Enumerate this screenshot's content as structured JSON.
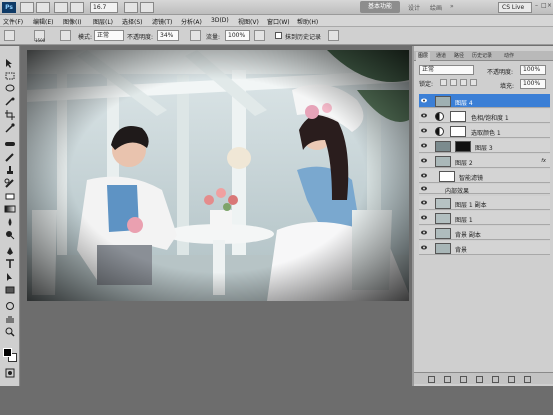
{
  "app": {
    "logo": "Ps",
    "zoom": "16.7",
    "workspace_active": "基本功能",
    "workspace_links": [
      "设计",
      "绘画"
    ],
    "cslive": "CS Live"
  },
  "menu": [
    "文件(F)",
    "编辑(E)",
    "图像(I)",
    "图层(L)",
    "选择(S)",
    "滤镜(T)",
    "分析(A)",
    "3D(D)",
    "视图(V)",
    "窗口(W)",
    "帮助(H)"
  ],
  "options": {
    "brush_size": "1500",
    "mode_label": "模式:",
    "mode_value": "正常",
    "opacity_label": "不透明度:",
    "opacity_value": "34%",
    "flow_label": "流量:",
    "flow_value": "100%",
    "history_label": "抹到历史记录"
  },
  "layers_panel": {
    "tabs": [
      "图层",
      "通道",
      "路径",
      "历史记录",
      "动作"
    ],
    "blend_mode": "正常",
    "opacity_label": "不透明度:",
    "opacity_value": "100%",
    "lock_label": "锁定:",
    "fill_label": "填充:",
    "fill_value": "100%",
    "layers": [
      {
        "name": "图层 4",
        "type": "pixel",
        "selected": true
      },
      {
        "name": "色相/饱和度 1",
        "type": "adjustment"
      },
      {
        "name": "选取颜色 1",
        "type": "adjustment"
      },
      {
        "name": "图层 3",
        "type": "pixel-mask"
      },
      {
        "name": "图层 2",
        "type": "smart",
        "fx": "fx"
      },
      {
        "name": "智能滤镜",
        "type": "smart-filter"
      },
      {
        "name": "内部效果",
        "type": "effect"
      },
      {
        "name": "图层 1 副本",
        "type": "pixel"
      },
      {
        "name": "图层 1",
        "type": "pixel"
      },
      {
        "name": "背景 副本",
        "type": "pixel"
      },
      {
        "name": "背景",
        "type": "pixel"
      }
    ]
  },
  "colors": {
    "selected_layer": "#3b7fd6",
    "panel_bg": "#cfcfcf",
    "workspace_bg": "#6d6d6d"
  }
}
